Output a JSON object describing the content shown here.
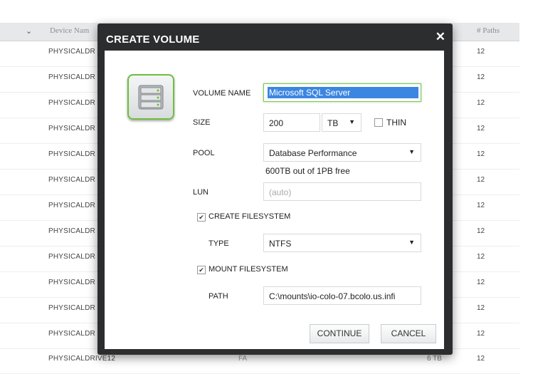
{
  "table": {
    "header": {
      "device_col": "Device Nam",
      "paths_col": "# Paths"
    },
    "rows": [
      {
        "name": "PHYSICALDR",
        "paths": "12"
      },
      {
        "name": "PHYSICALDR",
        "paths": "12"
      },
      {
        "name": "PHYSICALDR",
        "paths": "12"
      },
      {
        "name": "PHYSICALDR",
        "paths": "12"
      },
      {
        "name": "PHYSICALDR",
        "paths": "12"
      },
      {
        "name": "PHYSICALDR",
        "paths": "12"
      },
      {
        "name": "PHYSICALDR",
        "paths": "12"
      },
      {
        "name": "PHYSICALDR",
        "paths": "12"
      },
      {
        "name": "PHYSICALDR",
        "paths": "12"
      },
      {
        "name": "PHYSICALDR",
        "paths": "12"
      },
      {
        "name": "PHYSICALDR",
        "paths": "12"
      },
      {
        "name": "PHYSICALDR",
        "paths": "12"
      },
      {
        "name": "PHYSICALDRIVE12",
        "paths": "12",
        "fs": "FA",
        "size": "6 TB"
      }
    ]
  },
  "dialog": {
    "title": "CREATE VOLUME",
    "close_glyph": "✕",
    "icon": "database-icon",
    "accent_color": "#6cbf3c",
    "volume_name_label": "VOLUME NAME",
    "volume_name_value": "Microsoft SQL Server",
    "size_label": "SIZE",
    "size_value": "200",
    "size_unit": "TB",
    "thin_label": "THIN",
    "pool_label": "POOL",
    "pool_value": "Database Performance",
    "pool_free": "600TB out of 1PB free",
    "lun_label": "LUN",
    "lun_placeholder": "(auto)",
    "create_fs_label": "CREATE FILESYSTEM",
    "type_label": "TYPE",
    "type_value": "NTFS",
    "mount_fs_label": "MOUNT FILESYSTEM",
    "path_label": "PATH",
    "path_value": "C:\\mounts\\io-colo-07.bcolo.us.infi",
    "continue_label": "CONTINUE",
    "cancel_label": "CANCEL"
  }
}
